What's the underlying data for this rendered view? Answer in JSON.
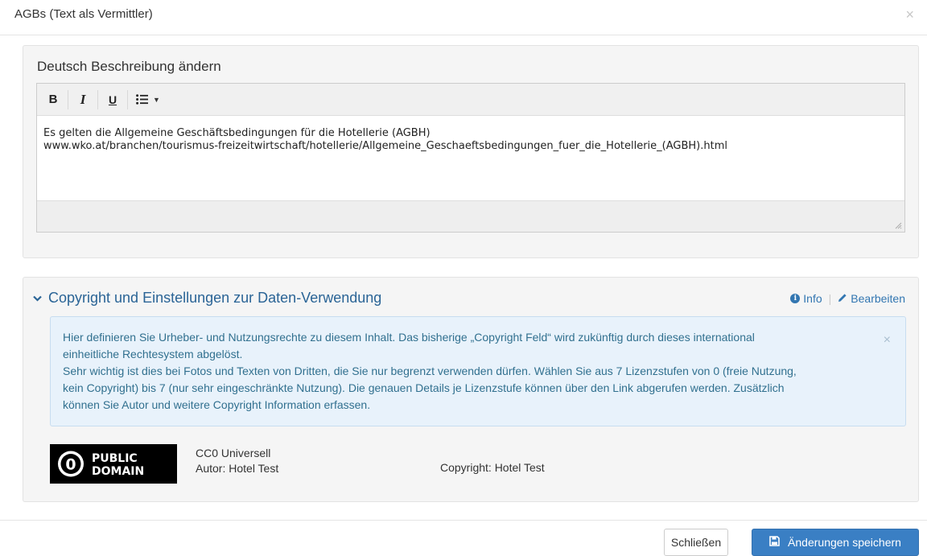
{
  "modal": {
    "title": "AGBs (Text als Vermittler)",
    "close_symbol": "×"
  },
  "editor": {
    "heading": "Deutsch Beschreibung ändern",
    "toolbar": {
      "bold": "B",
      "italic": "I",
      "underline": "U",
      "list_icon": "list-ul-icon",
      "dropdown_icon": "caret-down-icon"
    },
    "content_lines": [
      "Es gelten die Allgemeine Geschäftsbedingungen für die Hotellerie (AGBH)",
      "www.wko.at/branchen/tourismus-freizeitwirtschaft/hotellerie/Allgemeine_Geschaeftsbedingungen_fuer_die_Hotellerie_(AGBH).html"
    ]
  },
  "copyright": {
    "heading": "Copyright und Einstellungen zur Daten-Verwendung",
    "info_label": "Info",
    "edit_label": "Bearbeiten",
    "alert_lines": [
      "Hier definieren Sie Urheber- und Nutzungsrechte zu diesem Inhalt. Das bisherige „Copyright Feld“ wird zukünftig durch dieses international",
      "einheitliche Rechtesystem abgelöst.",
      "Sehr wichtig ist dies bei Fotos und Texten von Dritten, die Sie nur begrenzt verwenden dürfen. Wählen Sie aus 7 Lizenzstufen von 0 (freie Nutzung,",
      "kein Copyright) bis 7 (nur sehr eingeschränkte Nutzung). Die genauen Details je Lizenzstufe können über den Link abgerufen werden. Zusätzlich",
      "können Sie Autor und weitere Copyright Information erfassen."
    ],
    "alert_close": "×",
    "license_logo": {
      "line1": "PUBLIC",
      "line2": "DOMAIN",
      "digit": "0"
    },
    "license_name": "CC0 Universell",
    "author": "Autor: Hotel Test",
    "copyright_holder": "Copyright: Hotel Test"
  },
  "footer": {
    "close_label": "Schließen",
    "save_label": "Änderungen speichern"
  },
  "colors": {
    "link_blue": "#2a6496",
    "alert_bg": "#e8f2fb",
    "alert_text": "#31708f",
    "primary_button": "#3a7fc4"
  }
}
